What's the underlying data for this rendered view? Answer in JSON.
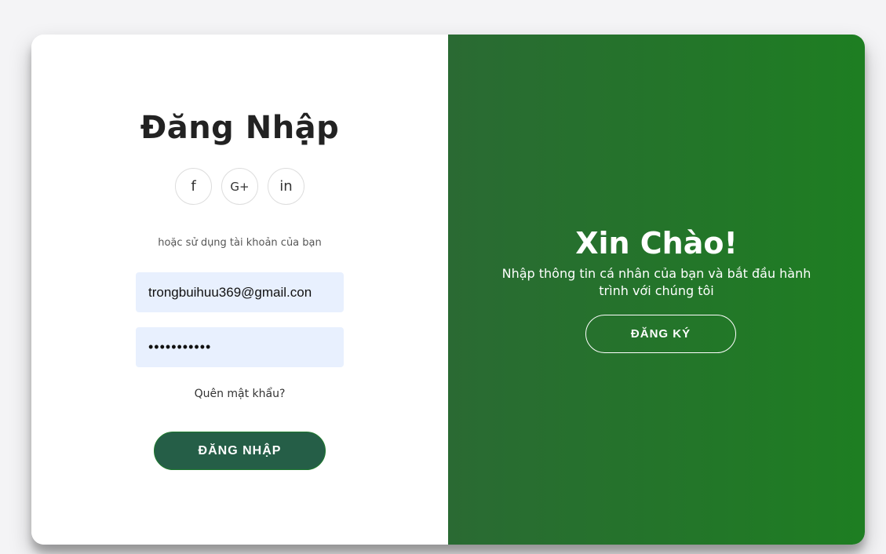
{
  "signin": {
    "title": "Đăng Nhập",
    "social": {
      "facebook": "f",
      "google": "G+",
      "linkedin": "in"
    },
    "alt_text": "hoặc sử dụng tài khoản của bạn",
    "email_value": "trongbuihuu369@gmail.con",
    "password_value": "•••••••••••",
    "forgot_link": "Quên mật khẩu?",
    "login_button": "ĐĂNG NHẬP"
  },
  "overlay": {
    "title": "Xin Chào!",
    "text": "Nhập thông tin cá nhân của bạn và bắt đầu hành trình với chúng tôi",
    "signup_button": "ĐĂNG KÝ"
  },
  "colors": {
    "primary_green": "#255e47",
    "overlay_start": "#2a6a33",
    "overlay_end": "#1e7e22",
    "input_bg": "#e8f0fe"
  }
}
